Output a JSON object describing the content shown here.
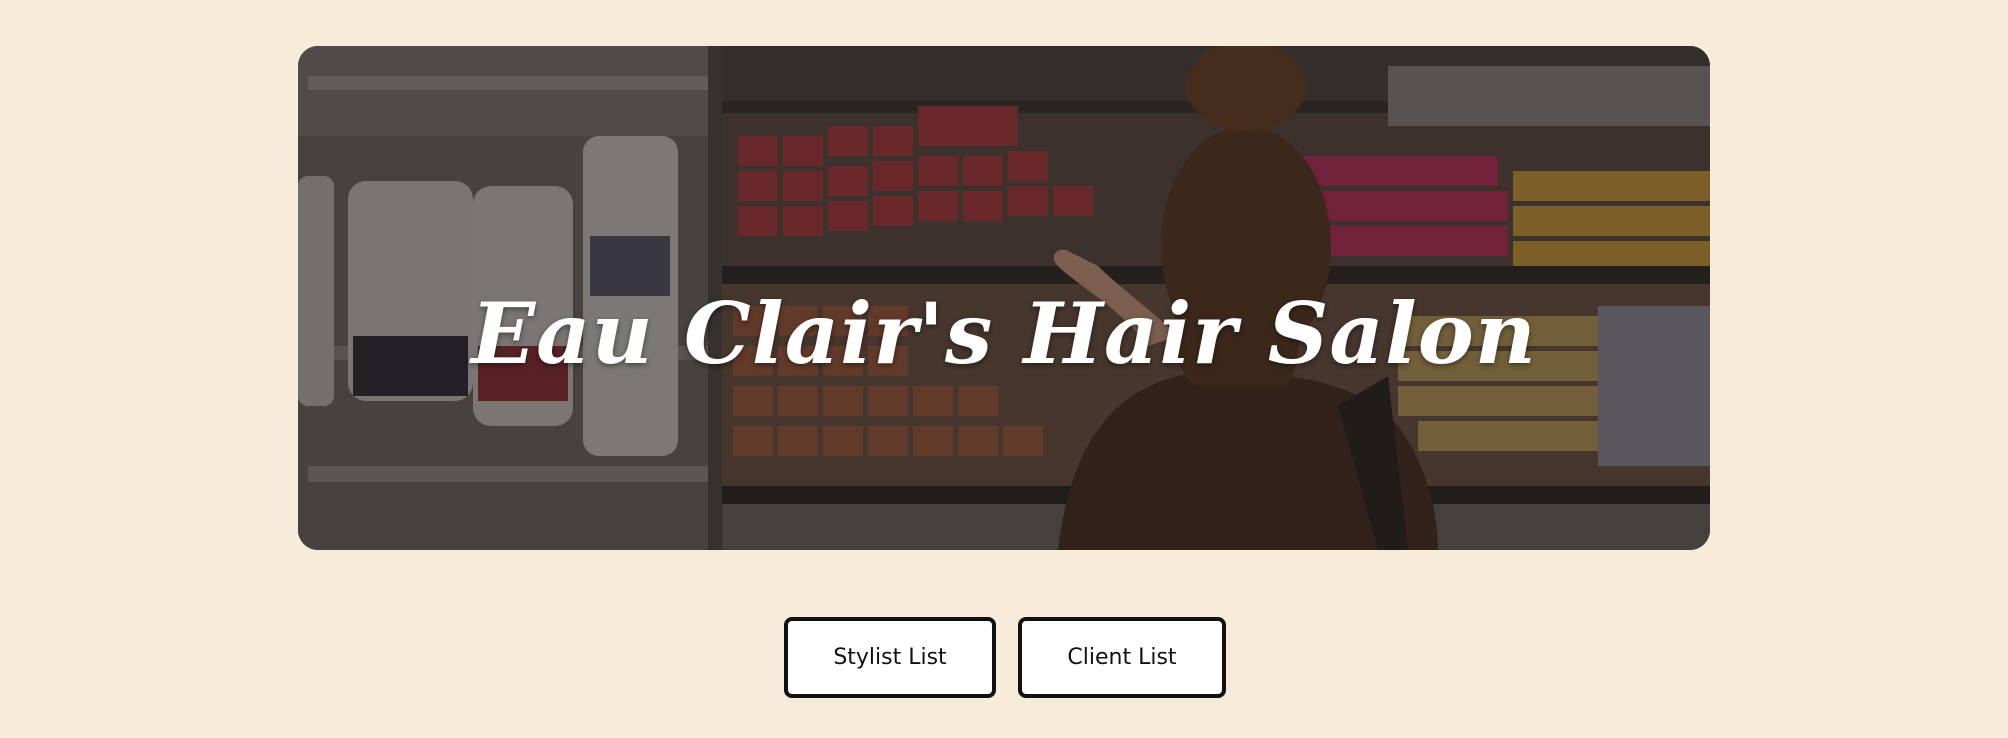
{
  "hero": {
    "title": "Eau Clair's Hair Salon",
    "image_icon": "hair-dye-shelves-photo"
  },
  "nav": {
    "stylist_label": "Stylist List",
    "client_label": "Client List"
  },
  "colors": {
    "background": "#f7ebd9",
    "button_bg": "#ffffff",
    "button_border": "#111111",
    "title_text": "#ffffff"
  }
}
